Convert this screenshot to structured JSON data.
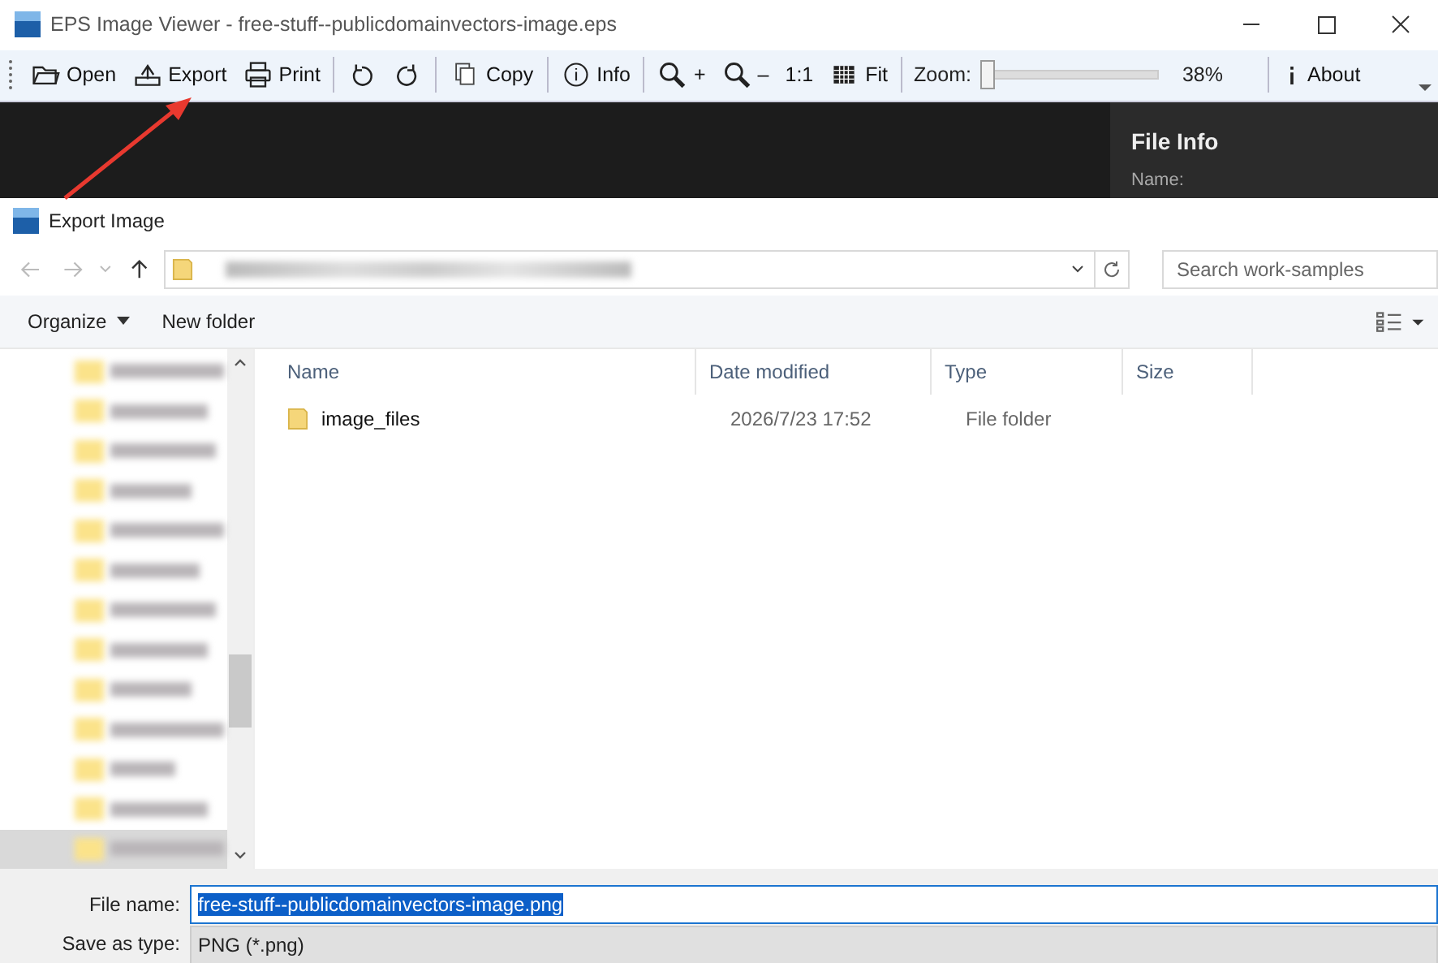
{
  "window": {
    "title": "EPS Image Viewer - free-stuff--publicdomainvectors-image.eps"
  },
  "toolbar": [
    {
      "kind": "button",
      "label": "Open"
    },
    {
      "kind": "button",
      "label": "Export"
    },
    {
      "kind": "button",
      "label": "Print"
    },
    {
      "kind": "sep"
    },
    {
      "kind": "button"
    },
    {
      "kind": "button"
    },
    {
      "kind": "sep"
    },
    {
      "kind": "button",
      "label": "Copy"
    },
    {
      "kind": "sep"
    },
    {
      "kind": "button",
      "label": "Info"
    },
    {
      "kind": "sep"
    },
    {
      "kind": "button",
      "label": "+"
    },
    {
      "kind": "button",
      "label": "–"
    },
    {
      "kind": "button",
      "label": "1:1"
    },
    {
      "kind": "button",
      "label": "Fit"
    },
    {
      "kind": "sep"
    },
    {
      "kind": "zoom",
      "label": "Zoom:",
      "level": 0.0,
      "reading": "38%"
    },
    {
      "kind": "sep"
    },
    {
      "kind": "button",
      "label": "About"
    }
  ],
  "info_panel": {
    "title": "File Info",
    "field": "Name:"
  },
  "dialog": {
    "title": "Export Image",
    "search": {
      "placeholder": "Search work-samples"
    },
    "commands": [
      {
        "label": "Organize"
      },
      {
        "label": "New folder"
      }
    ],
    "nav_items": [
      {
        "selected": false
      },
      {
        "selected": false
      },
      {
        "selected": false
      },
      {
        "selected": false
      },
      {
        "selected": false
      },
      {
        "selected": false
      },
      {
        "selected": false
      },
      {
        "selected": false
      },
      {
        "selected": false
      },
      {
        "selected": false
      },
      {
        "selected": false
      },
      {
        "selected": false
      },
      {
        "selected": true
      }
    ],
    "columns": [
      "Name",
      "Date modified",
      "Type",
      "Size"
    ],
    "rows": [
      {
        "name": "image_files",
        "date": "2026/7/23 17:52",
        "type": "File folder"
      }
    ],
    "file_name_label": "File name:",
    "file_name": "free-stuff--publicdomainvectors-image.png",
    "type_label": "Save as type:",
    "type_value": "PNG (*.png)"
  }
}
